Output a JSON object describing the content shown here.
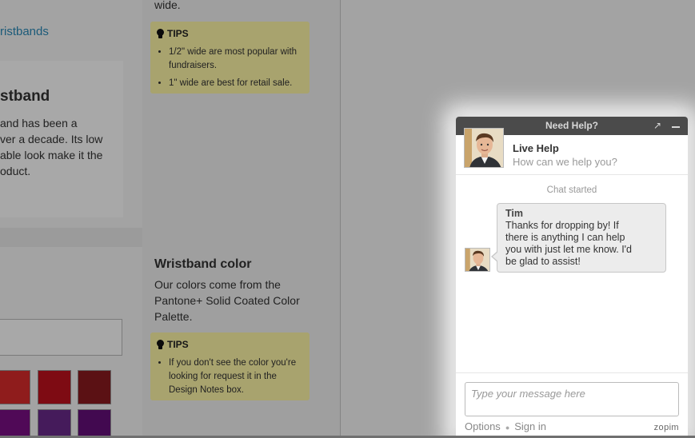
{
  "page": {
    "breadcrumb_link": "ristbands",
    "product_card": {
      "title": "stband",
      "text_lines": [
        "and has been a",
        "ver a decade. Its low",
        "able look make it the",
        "oduct."
      ]
    },
    "width_tail": "wide.",
    "tips_1": {
      "label": "TIPS",
      "items": [
        [
          "1/2\" wide are most popular with",
          "fundraisers."
        ],
        [
          "1\" wide are best for retail sale."
        ]
      ]
    },
    "color_section": {
      "title": "Wristband color",
      "text_lines": [
        "Our colors come from the",
        "Pantone+ Solid Coated Color",
        "Palette."
      ]
    },
    "tips_2": {
      "label": "TIPS",
      "items": [
        [
          "If you don't see the color you're",
          "looking for request it in the",
          "Design Notes box."
        ]
      ]
    },
    "swatch_colors": [
      "#d92b2b",
      "#c0121e",
      "#8a1a1f",
      "#7a0e84",
      "#6a2a8a",
      "#650f7a"
    ]
  },
  "chat": {
    "header_title": "Need Help?",
    "popout_icon": "↗",
    "agent_title": "Live Help",
    "agent_subtitle": "How can we help you?",
    "status": "Chat started",
    "message": {
      "sender": "Tim",
      "lines": [
        "Thanks for dropping by! If",
        "there is anything I can help",
        "you with just let me know. I'd",
        "be glad to assist!"
      ]
    },
    "input_placeholder": "Type your message here",
    "options_label": "Options",
    "separator": "●",
    "signin_label": "Sign in",
    "brand": "zopim"
  }
}
